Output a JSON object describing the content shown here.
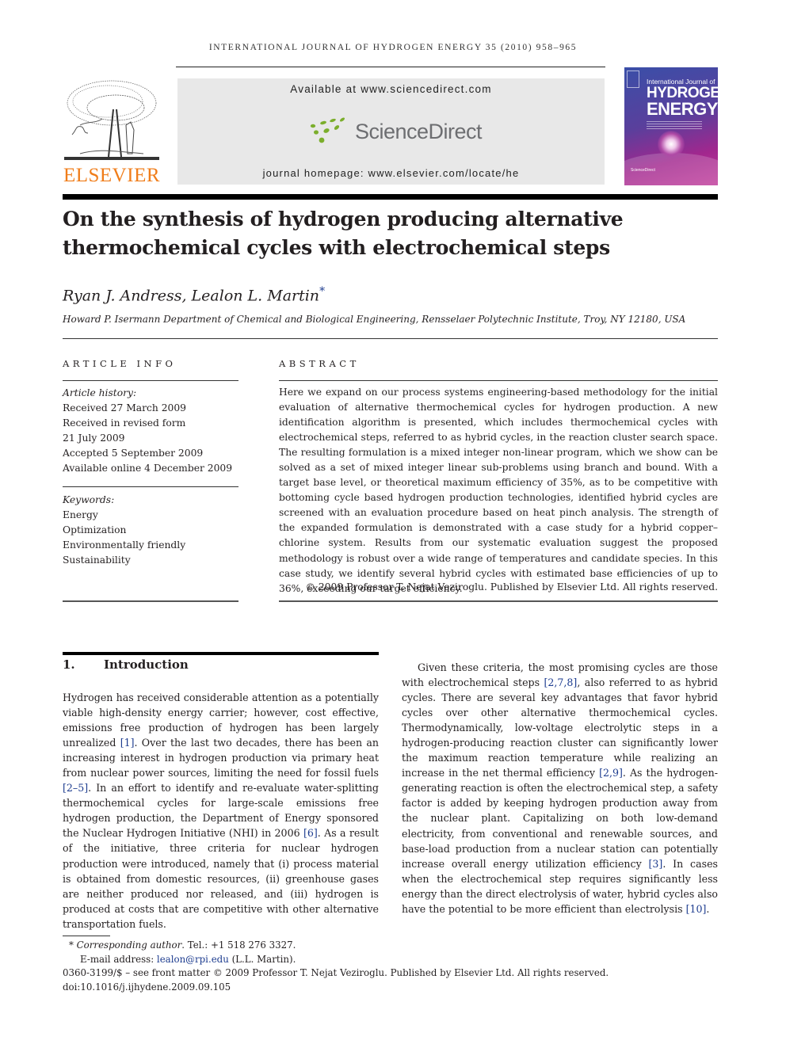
{
  "running_head": "INTERNATIONAL JOURNAL OF HYDROGEN ENERGY 35 (2010) 958–965",
  "masthead": {
    "publisher_logo_text": "ELSEVIER",
    "available_at": "Available at www.sciencedirect.com",
    "sciencedirect_logo_text": "ScienceDirect",
    "journal_homepage": "journal homepage: www.elsevier.com/locate/he",
    "cover": {
      "line1": "International Journal of",
      "line2": "HYDROGEN",
      "line3": "ENERGY",
      "footer": "ScienceDirect"
    },
    "colors": {
      "elsevier_orange": "#f07d1a",
      "sciencedirect_green": "#7bae2c",
      "sciencedirect_gray": "#6d6e71",
      "link_blue": "#1d3c8f"
    }
  },
  "article": {
    "title_line1": "On the synthesis of hydrogen producing alternative",
    "title_line2": "thermochemical cycles with electrochemical steps",
    "authors": "Ryan J. Andress, Lealon L. Martin",
    "author_marker": "*",
    "affiliation": "Howard P. Isermann Department of Chemical and Biological Engineering, Rensselaer Polytechnic Institute, Troy, NY 12180, USA"
  },
  "article_info": {
    "heading": "ARTICLE INFO",
    "history_label": "Article history:",
    "history": [
      "Received 27 March 2009",
      "Received in revised form",
      "21 July 2009",
      "Accepted 5 September 2009",
      "Available online 4 December 2009"
    ],
    "keywords_label": "Keywords:",
    "keywords": [
      "Energy",
      "Optimization",
      "Environmentally friendly",
      "Sustainability"
    ]
  },
  "abstract": {
    "heading": "ABSTRACT",
    "text": "Here we expand on our process systems engineering-based methodology for the initial evaluation of alternative thermochemical cycles for hydrogen production. A new identification algorithm is presented, which includes thermochemical cycles with electrochemical steps, referred to as hybrid cycles, in the reaction cluster search space. The resulting formulation is a mixed integer non-linear program, which we show can be solved as a set of mixed integer linear sub-problems using branch and bound. With a target base level, or theoretical maximum efficiency of 35%, as to be competitive with bottoming cycle based hydrogen production technologies, identified hybrid cycles are screened with an evaluation procedure based on heat pinch analysis. The strength of the expanded formulation is demonstrated with a case study for a hybrid copper–chlorine system. Results from our systematic evaluation suggest the proposed methodology is robust over a wide range of temperatures and candidate species. In this case study, we identify several hybrid cycles with estimated base efficiencies of up to 36%, exceeding our target efficiency.",
    "copyright": "© 2009 Professor T. Nejat Veziroglu. Published by Elsevier Ltd. All rights reserved."
  },
  "introduction": {
    "number": "1.",
    "heading": "Introduction",
    "col1": [
      {
        "t": "Hydrogen has received considerable attention as a potentially viable high-density energy carrier; however, cost effective, emissions free production of hydrogen has been largely unrealized "
      },
      {
        "r": "[1]"
      },
      {
        "t": ". Over the last two decades, there has been an increasing interest in hydrogen production via primary heat from nuclear power sources, limiting the need for fossil fuels "
      },
      {
        "r": "[2–5]"
      },
      {
        "t": ". In an effort to identify and re-evaluate water-splitting thermochemical cycles for large-scale emissions free hydrogen production, the Department of Energy sponsored the Nuclear Hydrogen Initiative (NHI) in 2006 "
      },
      {
        "r": "[6]"
      },
      {
        "t": ". As a result of the initiative, three criteria for nuclear hydrogen production were introduced, namely that (i) process material is obtained from domestic resources, (ii) greenhouse gases are neither produced nor released, and (iii) hydrogen is produced at costs that are competitive with other alternative transportation fuels."
      }
    ],
    "col2": [
      {
        "t": "Given these criteria, the most promising cycles are those with electrochemical steps "
      },
      {
        "r": "[2,7,8]"
      },
      {
        "t": ", also referred to as hybrid cycles. There are several key advantages that favor hybrid cycles over other alternative thermochemical cycles. Thermodynamically, low-voltage electrolytic steps in a hydrogen-producing reaction cluster can significantly lower the maximum reaction temperature while realizing an increase in the net thermal efficiency "
      },
      {
        "r": "[2,9]"
      },
      {
        "t": ". As the hydrogen-generating reaction is often the electrochemical step, a safety factor is added by keeping hydrogen production away from the nuclear plant. Capitalizing on both low-demand electricity, from conventional and renewable sources, and base-load production from a nuclear station can potentially increase overall energy utilization efficiency "
      },
      {
        "r": "[3]"
      },
      {
        "t": ". In cases when the electrochemical step requires significantly less energy than the direct electrolysis of water, hybrid cycles also have the potential to be more efficient than electrolysis "
      },
      {
        "r": "[10]"
      },
      {
        "t": "."
      }
    ]
  },
  "footnotes": {
    "marker": "*",
    "corresponding_label": "Corresponding author",
    "tel": ". Tel.: +1 518 276 3327.",
    "email_label": "E-mail address: ",
    "email": "lealon@rpi.edu",
    "email_suffix": " (L.L. Martin).",
    "issn_line": "0360-3199/$ – see front matter © 2009 Professor T. Nejat Veziroglu. Published by Elsevier Ltd. All rights reserved.",
    "doi": "doi:10.1016/j.ijhydene.2009.09.105"
  }
}
